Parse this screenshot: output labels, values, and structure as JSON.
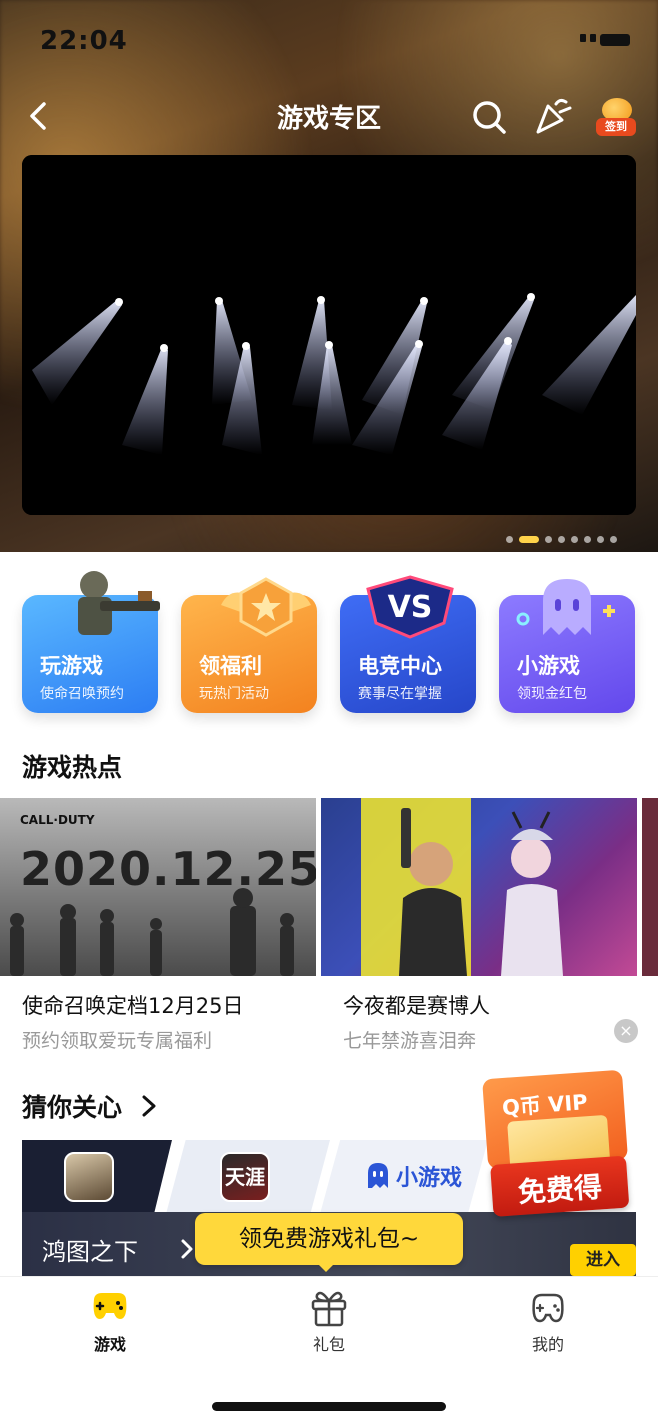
{
  "status_bar": {
    "time": "22:04"
  },
  "nav": {
    "title": "游戏专区",
    "sign_label": "签到"
  },
  "banner": {
    "page_count": 8,
    "active_index": 1
  },
  "quick_entries": [
    {
      "title": "玩游戏",
      "subtitle": "使命召唤预约"
    },
    {
      "title": "领福利",
      "subtitle": "玩热门活动"
    },
    {
      "title": "电竞中心",
      "subtitle": "赛事尽在掌握",
      "badge": "VS"
    },
    {
      "title": "小游戏",
      "subtitle": "领现金红包"
    }
  ],
  "hot": {
    "title": "游戏热点",
    "items": [
      {
        "image_logo": "CALL·DUTY",
        "image_text": "2020.12.25",
        "title": "使命召唤定档12月25日",
        "subtitle": "预约领取爱玩专属福利"
      },
      {
        "title": "今夜都是赛博人",
        "subtitle": "七年禁游喜泪奔"
      }
    ],
    "close_glyph": "×"
  },
  "care": {
    "title": "猜你关心",
    "strip": {
      "game2_text": "天涯",
      "mini_game_label": "小游戏"
    },
    "game_name": "鸿图之下",
    "enter_label": "进入"
  },
  "tooltip": {
    "text": "领免费游戏礼包~"
  },
  "vip_promo": {
    "title": "Q币 VIP",
    "cta": "免费得"
  },
  "tabbar": {
    "tabs": [
      {
        "label": "游戏",
        "icon": "gamepad-icon",
        "active": true
      },
      {
        "label": "礼包",
        "icon": "gift-icon",
        "active": false
      },
      {
        "label": "我的",
        "icon": "user-game-icon",
        "active": false
      }
    ]
  },
  "colors": {
    "accent": "#ffd34a",
    "tab_active": "#ffd000"
  }
}
